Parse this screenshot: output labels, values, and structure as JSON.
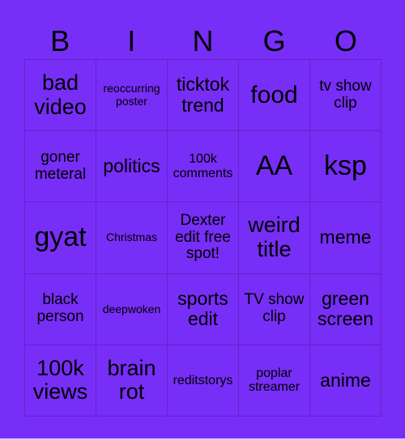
{
  "header": [
    "B",
    "I",
    "N",
    "G",
    "O"
  ],
  "cells": [
    [
      "bad video",
      "reoccurring poster",
      "ticktok trend",
      "food",
      "tv show clip"
    ],
    [
      "goner meteral",
      "politics",
      "100k comments",
      "AA",
      "ksp"
    ],
    [
      "gyat",
      "Christmas",
      "Dexter edit free spot!",
      "weird title",
      "meme"
    ],
    [
      "black person",
      "deepwoken",
      "sports edit",
      "TV show clip",
      "green screen"
    ],
    [
      "100k views",
      "brain rot",
      "reditstorys",
      "poplar streamer",
      "anime"
    ]
  ],
  "colors": {
    "background": "#772ef6",
    "border": "#6a20c8",
    "text": "#000000"
  }
}
